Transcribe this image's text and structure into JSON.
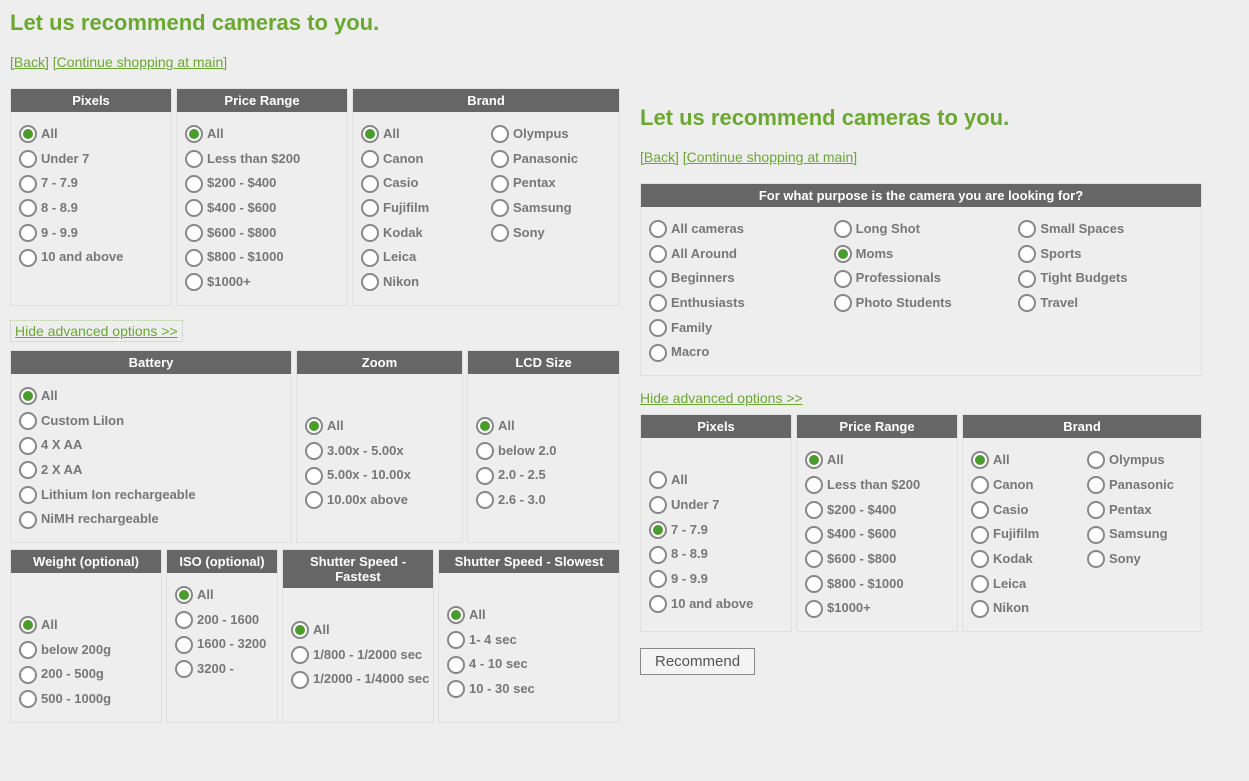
{
  "common": {
    "title": "Let us recommend cameras to you.",
    "back_link": "[Back]",
    "continue_link": "[Continue shopping at main]",
    "hide_advanced": "Hide advanced options >>",
    "recommend_button": "Recommend"
  },
  "left_panel": {
    "row1": {
      "pixels": {
        "header": "Pixels",
        "selected": "All",
        "options": [
          "All",
          "Under 7",
          "7 - 7.9",
          "8 - 8.9",
          "9 - 9.9",
          "10 and above"
        ]
      },
      "price": {
        "header": "Price Range",
        "selected": "All",
        "options": [
          "All",
          "Less than $200",
          "$200 - $400",
          "$400 - $600",
          "$600 - $800",
          "$800 - $1000",
          "$1000+"
        ]
      },
      "brand": {
        "header": "Brand",
        "selected": "All",
        "col1": [
          "All",
          "Canon",
          "Casio",
          "Fujifilm",
          " Kodak",
          "Leica",
          "Nikon"
        ],
        "col2": [
          "Olympus",
          "Panasonic",
          "Pentax",
          "Samsung",
          "Sony"
        ]
      }
    },
    "row2": {
      "battery": {
        "header": "Battery",
        "selected": "All",
        "options": [
          "All",
          "Custom LiIon",
          "4 X AA",
          "2 X AA",
          "Lithium Ion rechargeable",
          "NiMH rechargeable"
        ]
      },
      "zoom": {
        "header": "Zoom",
        "selected": "All",
        "options": [
          "All",
          "3.00x - 5.00x",
          "5.00x - 10.00x",
          "10.00x above"
        ]
      },
      "lcd": {
        "header": "LCD Size",
        "selected": "All",
        "options": [
          "All",
          "below 2.0",
          "2.0 - 2.5",
          "2.6 - 3.0"
        ]
      }
    },
    "row3": {
      "weight": {
        "header": "Weight (optional)",
        "selected": "All",
        "options": [
          "All",
          "below 200g",
          "200 - 500g",
          "500 - 1000g"
        ]
      },
      "iso": {
        "header": "ISO (optional)",
        "selected": "All",
        "options": [
          "All",
          "200 - 1600",
          "1600 - 3200",
          "3200 -"
        ]
      },
      "shutter_fast": {
        "header": "Shutter Speed - Fastest",
        "selected": "All",
        "options": [
          "All",
          "1/800 - 1/2000 sec",
          "1/2000 - 1/4000 sec"
        ]
      },
      "shutter_slow": {
        "header": "Shutter Speed - Slowest",
        "selected": "All",
        "options": [
          "All",
          "1- 4 sec",
          "4 - 10 sec",
          "10 - 30 sec"
        ]
      }
    }
  },
  "right_panel": {
    "purpose": {
      "header": "For what purpose is the camera you are looking for?",
      "selected": "Moms",
      "col1": [
        "All cameras",
        "All Around",
        "Beginners",
        "Enthusiasts",
        "Family",
        "Macro"
      ],
      "col2": [
        "Long Shot",
        "Moms",
        "Professionals",
        "Photo Students"
      ],
      "col3": [
        "Small Spaces",
        "Sports",
        "Tight Budgets",
        "Travel"
      ]
    },
    "row2": {
      "pixels": {
        "header": "Pixels",
        "selected": "7 - 7.9",
        "options": [
          "All",
          "Under 7",
          "7 - 7.9",
          "8 - 8.9",
          "9 - 9.9",
          "10 and above"
        ]
      },
      "price": {
        "header": "Price Range",
        "selected": "All",
        "options": [
          "All",
          "Less than $200",
          "$200 - $400",
          "$400 - $600",
          "$600 - $800",
          "$800 - $1000",
          "$1000+"
        ]
      },
      "brand": {
        "header": "Brand",
        "selected": "All",
        "col1": [
          "All",
          "Canon",
          "Casio",
          "Fujifilm",
          " Kodak",
          "Leica",
          "Nikon"
        ],
        "col2": [
          "Olympus",
          "Panasonic",
          "Pentax",
          "Samsung",
          "Sony"
        ]
      }
    }
  }
}
